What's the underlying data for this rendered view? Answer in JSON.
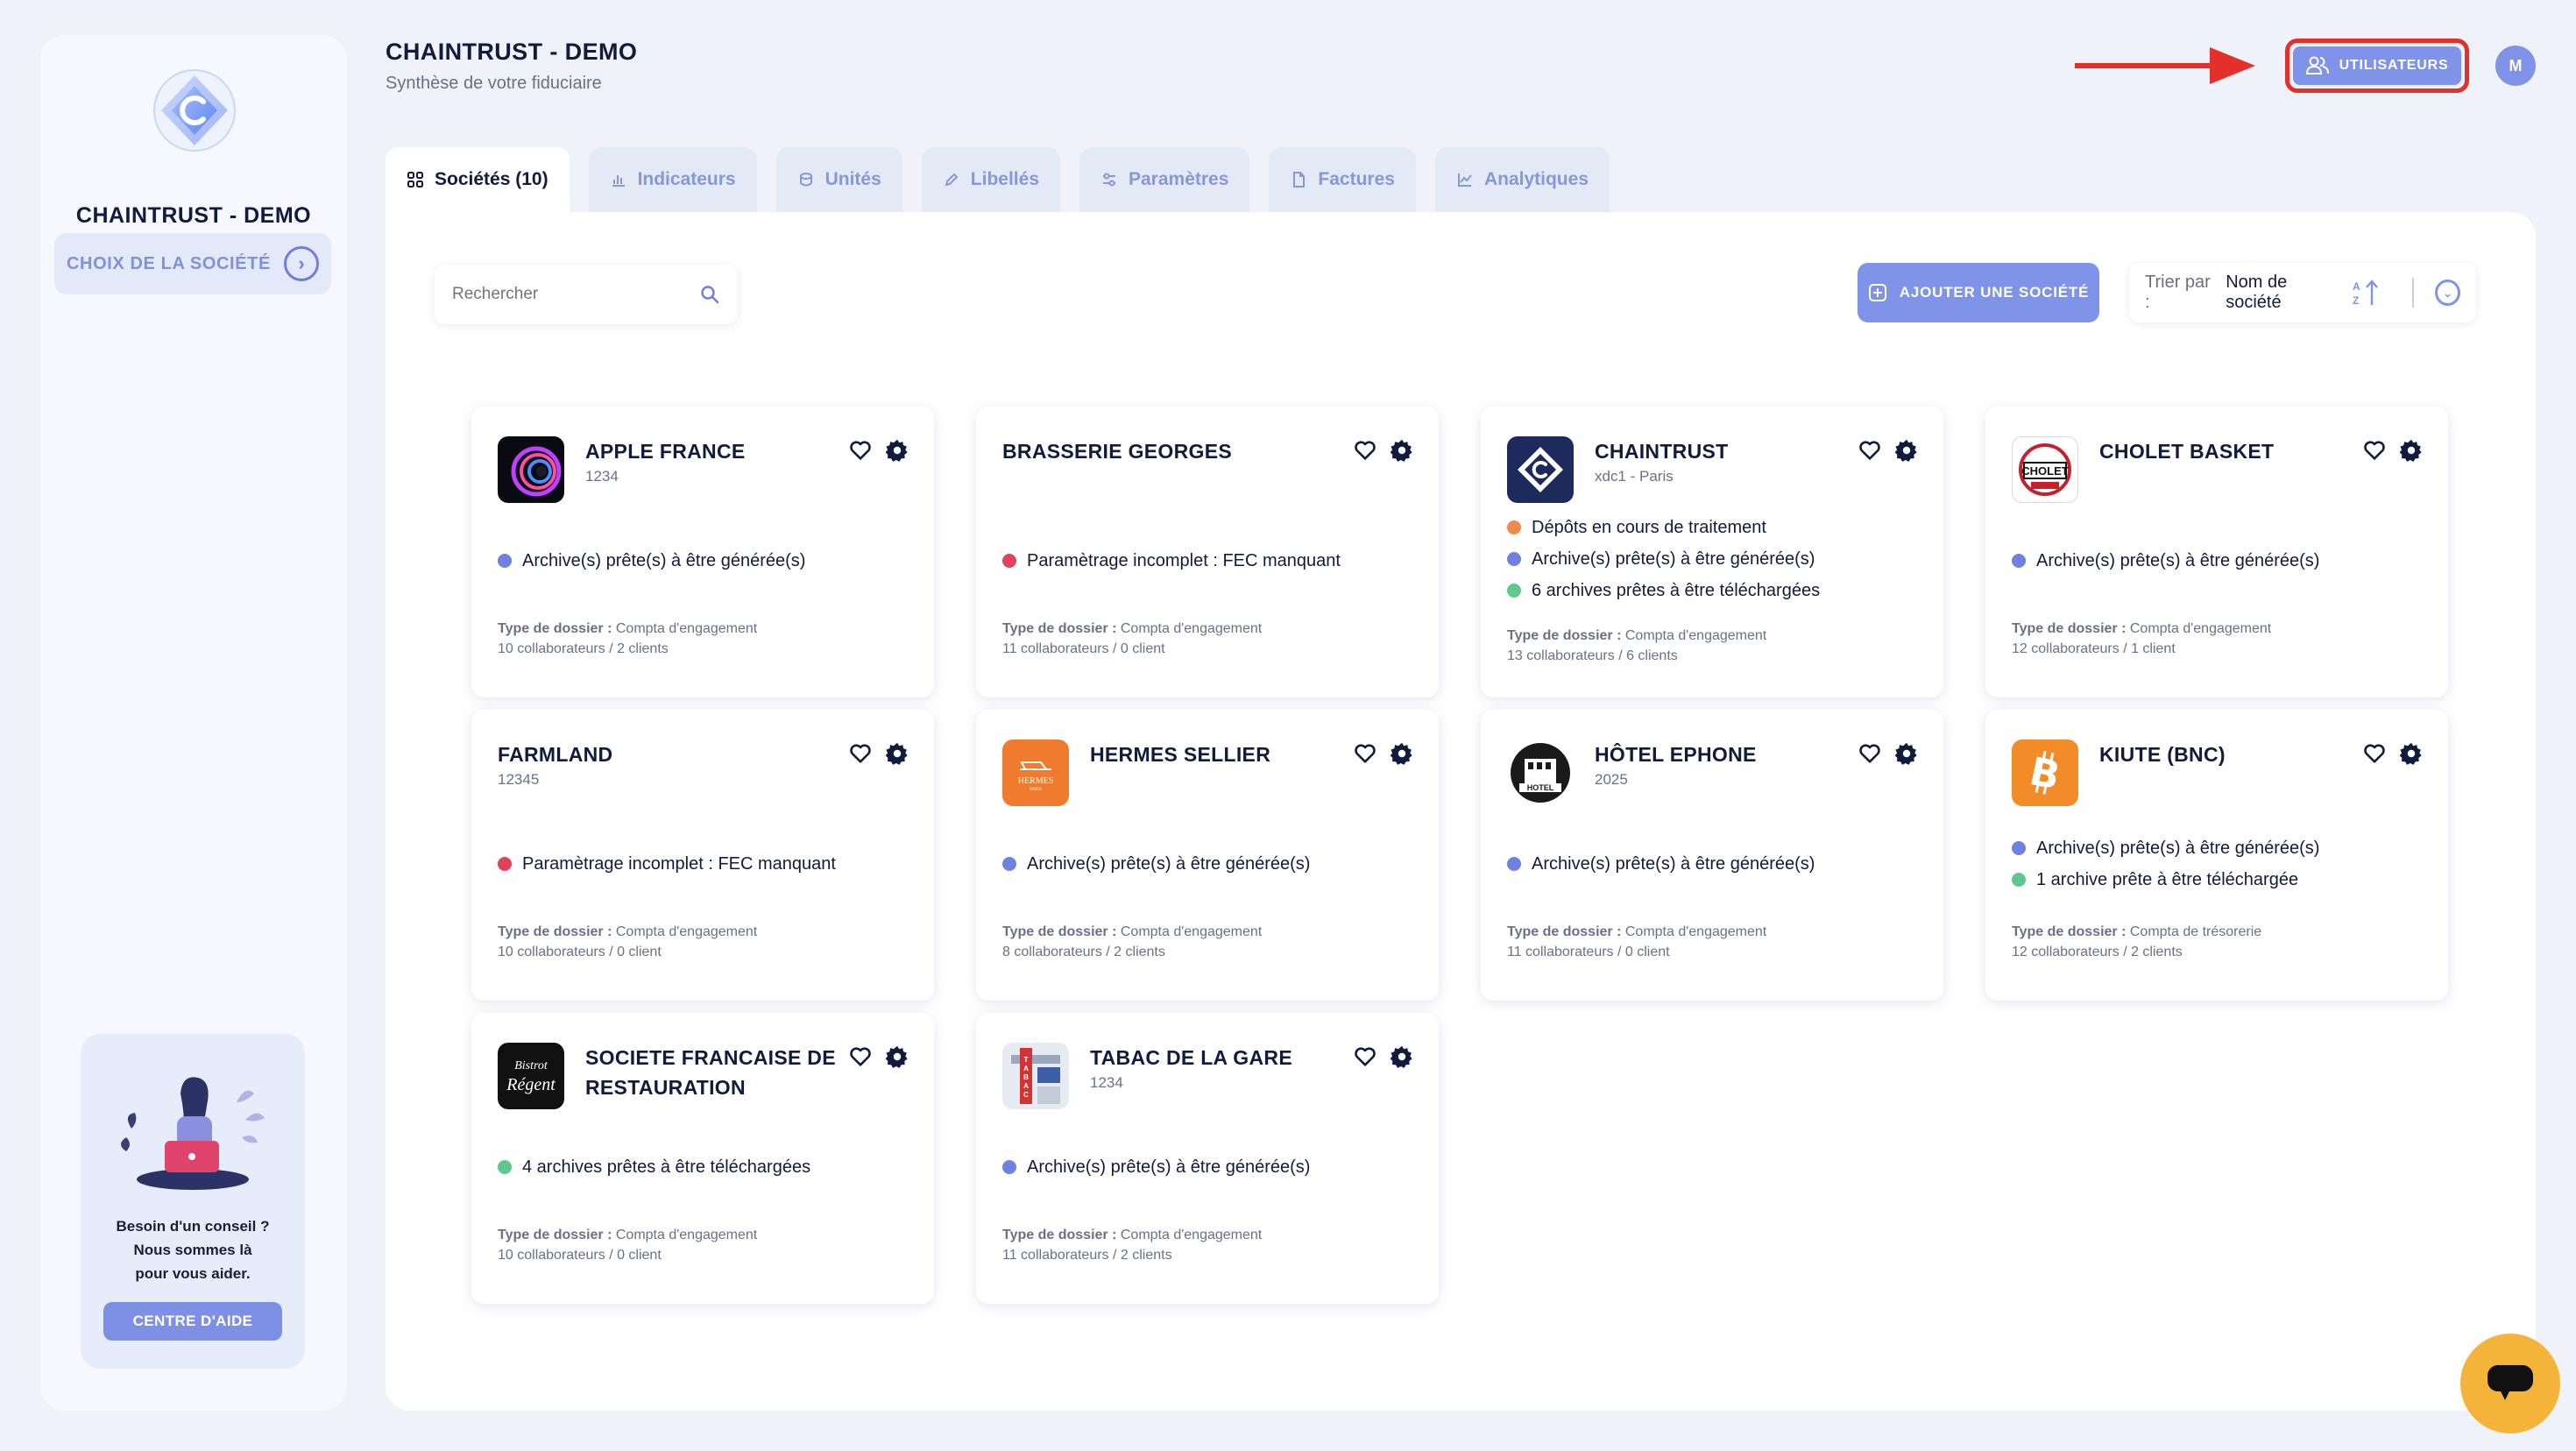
{
  "sidebar": {
    "company": "CHAINTRUST - DEMO",
    "choice_label": "CHOIX DE LA SOCIÉTÉ",
    "help_text": "Besoin d'un conseil ?\nNous sommes là\npour vous aider.",
    "help_button": "CENTRE D'AIDE"
  },
  "header": {
    "title": "CHAINTRUST - DEMO",
    "subtitle": "Synthèse de votre fiduciaire",
    "users_button": "UTILISATEURS",
    "avatar_initial": "M"
  },
  "tabs": [
    {
      "label": "Sociétés (10)",
      "icon": "grid-icon",
      "active": true
    },
    {
      "label": "Indicateurs",
      "icon": "chart-bar-icon",
      "active": false
    },
    {
      "label": "Unités",
      "icon": "coin-icon",
      "active": false
    },
    {
      "label": "Libellés",
      "icon": "pencil-icon",
      "active": false
    },
    {
      "label": "Paramètres",
      "icon": "sliders-icon",
      "active": false
    },
    {
      "label": "Factures",
      "icon": "document-icon",
      "active": false
    },
    {
      "label": "Analytiques",
      "icon": "line-chart-icon",
      "active": false
    }
  ],
  "toolbar": {
    "search_placeholder": "Rechercher",
    "add_button": "AJOUTER UNE SOCIÉTÉ",
    "sort_label": "Trier par :",
    "sort_value": "Nom de société"
  },
  "meta_label": "Type de dossier :",
  "status_colors": {
    "blue": "#6f82e0",
    "red": "#e0435a",
    "orange": "#f08a4b",
    "green": "#5fc88f"
  },
  "companies": [
    {
      "name": "APPLE FRANCE",
      "name2": "",
      "code": "1234",
      "logo": "apple-logo",
      "statuses": [
        {
          "color": "blue",
          "text": "Archive(s) prête(s) à être générée(s)"
        }
      ],
      "type": "Compta d'engagement",
      "counts": "10 collaborateurs / 2 clients"
    },
    {
      "name": "BRASSERIE GEORGES",
      "name2": "",
      "code": "",
      "logo": "",
      "statuses": [
        {
          "color": "red",
          "text": "Paramètrage incomplet : FEC manquant"
        }
      ],
      "type": "Compta d'engagement",
      "counts": "11 collaborateurs / 0 client"
    },
    {
      "name": "CHAINTRUST",
      "name2": "",
      "code": "xdc1 - Paris",
      "logo": "chaintrust-logo",
      "statuses": [
        {
          "color": "orange",
          "text": "Dépôts en cours de traitement"
        },
        {
          "color": "blue",
          "text": "Archive(s) prête(s) à être générée(s)"
        },
        {
          "color": "green",
          "text": "6 archives prêtes à être téléchargées"
        }
      ],
      "type": "Compta d'engagement",
      "counts": "13 collaborateurs / 6 clients"
    },
    {
      "name": "CHOLET BASKET",
      "name2": "",
      "code": "",
      "logo": "cholet-logo",
      "statuses": [
        {
          "color": "blue",
          "text": "Archive(s) prête(s) à être générée(s)"
        }
      ],
      "type": "Compta d'engagement",
      "counts": "12 collaborateurs / 1 client"
    },
    {
      "name": "FARMLAND",
      "name2": "",
      "code": "12345",
      "logo": "",
      "statuses": [
        {
          "color": "red",
          "text": "Paramètrage incomplet : FEC manquant"
        }
      ],
      "type": "Compta d'engagement",
      "counts": "10 collaborateurs / 0 client"
    },
    {
      "name": "HERMES SELLIER",
      "name2": "",
      "code": "",
      "logo": "hermes-logo",
      "statuses": [
        {
          "color": "blue",
          "text": "Archive(s) prête(s) à être générée(s)"
        }
      ],
      "type": "Compta d'engagement",
      "counts": "8 collaborateurs / 2 clients"
    },
    {
      "name": "HÔTEL EPHONE",
      "name2": "",
      "code": "2025",
      "logo": "hotel-logo",
      "statuses": [
        {
          "color": "blue",
          "text": "Archive(s) prête(s) à être générée(s)"
        }
      ],
      "type": "Compta d'engagement",
      "counts": "11 collaborateurs / 0 client"
    },
    {
      "name": "KIUTE (BNC)",
      "name2": "",
      "code": "",
      "logo": "bitcoin-logo",
      "statuses": [
        {
          "color": "blue",
          "text": "Archive(s) prête(s) à être générée(s)"
        },
        {
          "color": "green",
          "text": "1 archive prête à être téléchargée"
        }
      ],
      "type": "Compta de trésorerie",
      "counts": "12 collaborateurs / 2 clients"
    },
    {
      "name": "SOCIETE FRANCAISE DE",
      "name2": "RESTAURATION",
      "code": "",
      "logo": "bistro-logo",
      "statuses": [
        {
          "color": "green",
          "text": "4 archives prêtes à être téléchargées"
        }
      ],
      "type": "Compta d'engagement",
      "counts": "10 collaborateurs / 0 client"
    },
    {
      "name": "TABAC DE LA GARE",
      "name2": "",
      "code": "1234",
      "logo": "tabac-logo",
      "statuses": [
        {
          "color": "blue",
          "text": "Archive(s) prête(s) à être générée(s)"
        }
      ],
      "type": "Compta d'engagement",
      "counts": "11 collaborateurs / 2 clients"
    }
  ]
}
